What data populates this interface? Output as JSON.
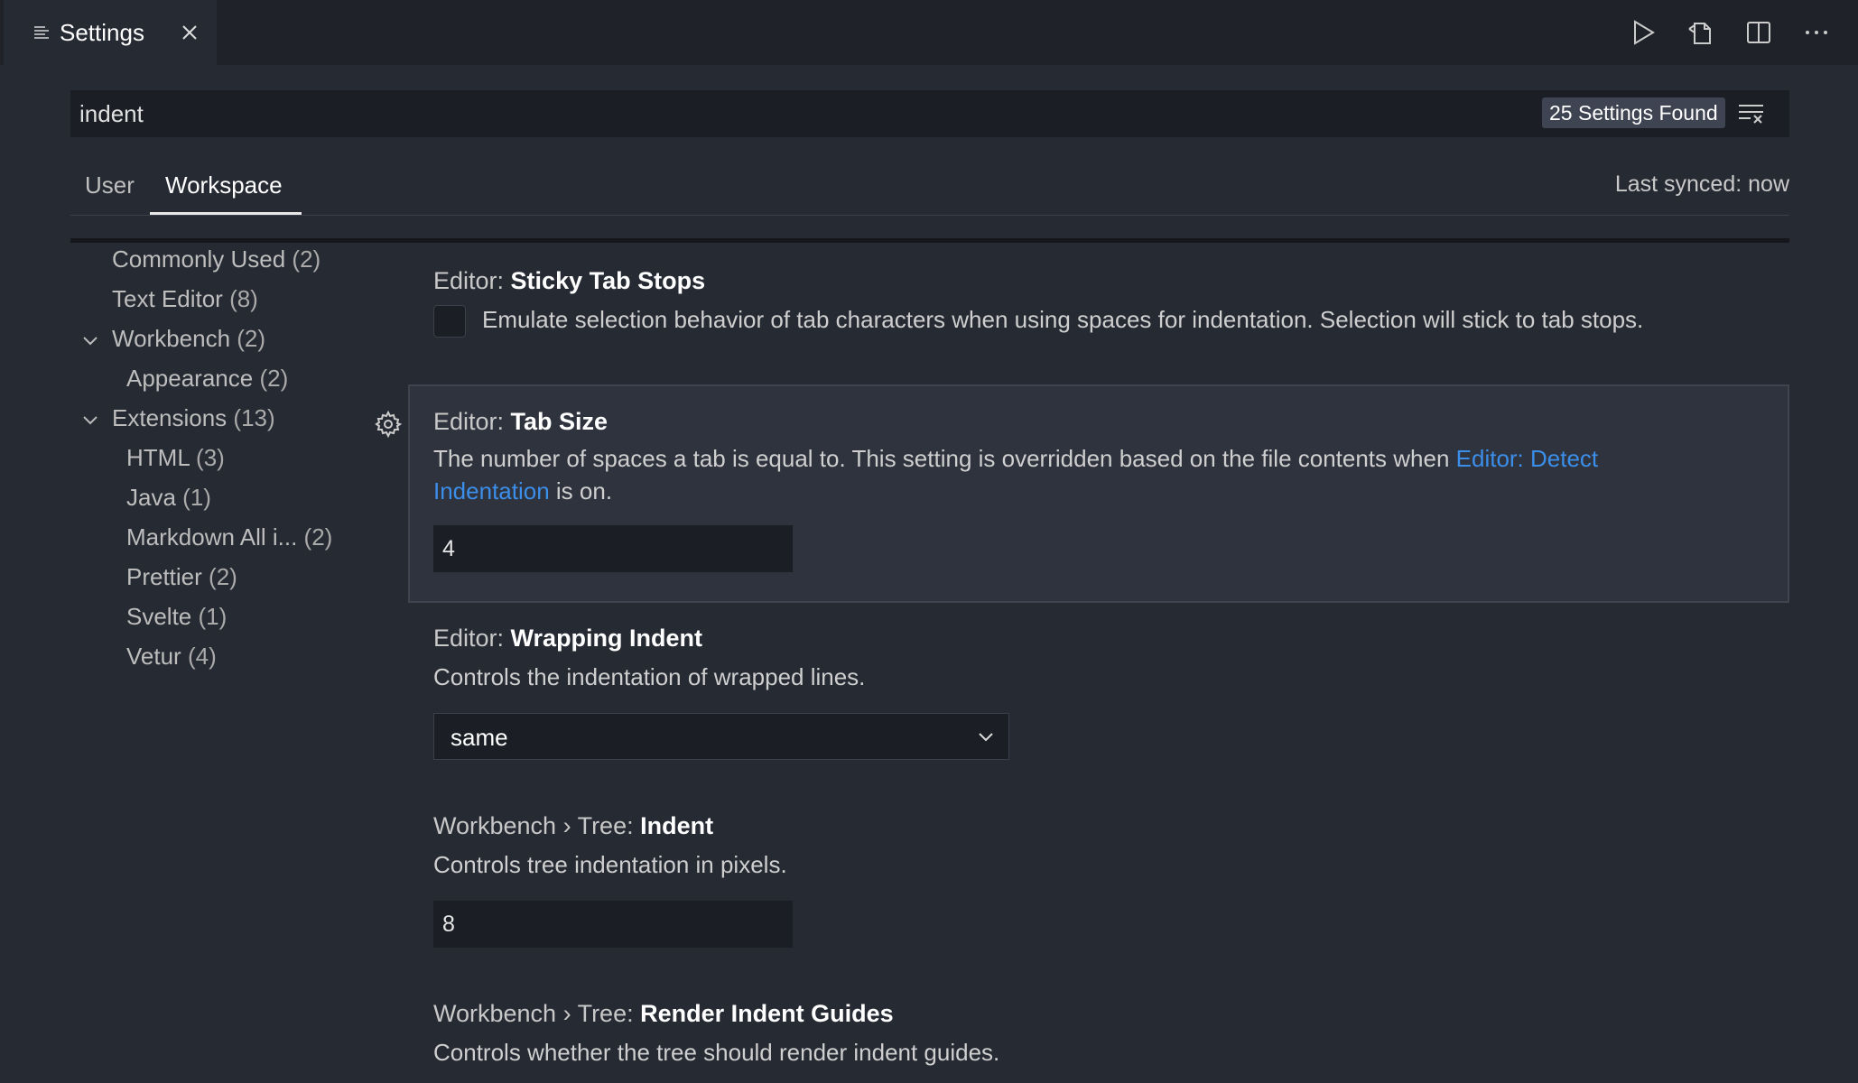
{
  "tab": {
    "label": "Settings"
  },
  "search": {
    "value": "indent",
    "results": "25 Settings Found"
  },
  "scope": {
    "user": "User",
    "workspace": "Workspace",
    "synced": "Last synced: now"
  },
  "toc": [
    {
      "label": "Commonly Used",
      "count": "(2)"
    },
    {
      "label": "Text Editor",
      "count": "(8)"
    },
    {
      "label": "Workbench",
      "count": "(2)"
    },
    {
      "label": "Appearance",
      "count": "(2)"
    },
    {
      "label": "Extensions",
      "count": "(13)"
    },
    {
      "label": "HTML",
      "count": "(3)"
    },
    {
      "label": "Java",
      "count": "(1)"
    },
    {
      "label": "Markdown All i...",
      "count": "(2)"
    },
    {
      "label": "Prettier",
      "count": "(2)"
    },
    {
      "label": "Svelte",
      "count": "(1)"
    },
    {
      "label": "Vetur",
      "count": "(4)"
    }
  ],
  "settings": {
    "sticky": {
      "category": "Editor: ",
      "name": "Sticky Tab Stops",
      "desc": "Emulate selection behavior of tab characters when using spaces for indentation. Selection will stick to tab stops.",
      "checked": false
    },
    "tabsize": {
      "category": "Editor: ",
      "name": "Tab Size",
      "desc_before": "The number of spaces a tab is equal to. This setting is overridden based on the file contents when ",
      "link": "Editor: Detect Indentation",
      "desc_after": " is on.",
      "value": "4"
    },
    "wrapping": {
      "category": "Editor: ",
      "name": "Wrapping Indent",
      "desc": "Controls the indentation of wrapped lines.",
      "value": "same"
    },
    "tree_indent": {
      "category": "Workbench › Tree: ",
      "name": "Indent",
      "desc": "Controls tree indentation in pixels.",
      "value": "8"
    },
    "indent_guides": {
      "category": "Workbench › Tree: ",
      "name": "Render Indent Guides",
      "desc": "Controls whether the tree should render indent guides."
    }
  },
  "colors": {
    "accent_link": "#3b8eea",
    "background": "#262a33",
    "input": "#1b1e24"
  }
}
